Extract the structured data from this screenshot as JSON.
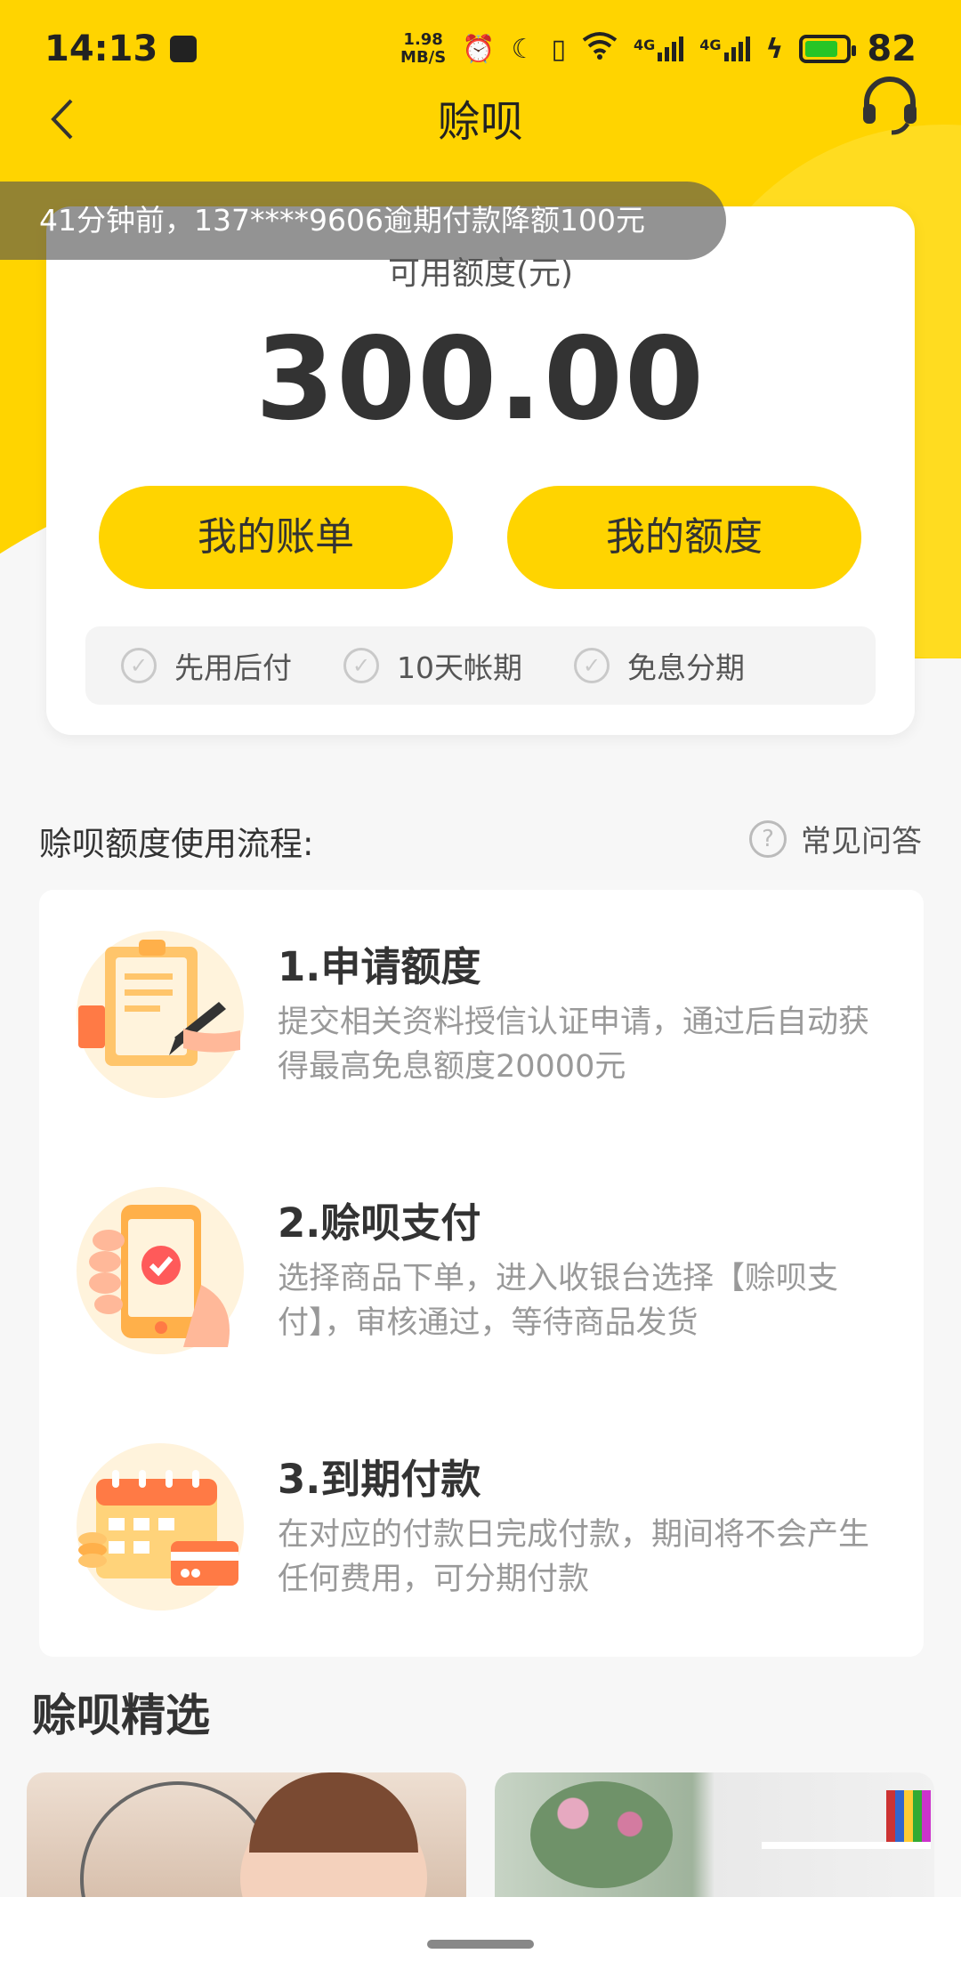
{
  "status_bar": {
    "time": "14:13",
    "net_speed_value": "1.98",
    "net_speed_unit": "MB/S",
    "network_1": "4G",
    "network_2": "4G",
    "battery": "82"
  },
  "nav": {
    "title": "赊呗"
  },
  "ticker": {
    "text": "41分钟前，137****9606逾期付款降额100元"
  },
  "credit": {
    "label": "可用额度(元)",
    "amount": "300.00",
    "bill_button": "我的账单",
    "quota_button": "我的额度",
    "features": [
      "先用后付",
      "10天帐期",
      "免息分期"
    ]
  },
  "process": {
    "title": "赊呗额度使用流程:",
    "faq": "常见问答",
    "steps": [
      {
        "title": "1.申请额度",
        "desc": "提交相关资料授信认证申请，通过后自动获得最高免息额度20000元"
      },
      {
        "title": "2.赊呗支付",
        "desc": "选择商品下单，进入收银台选择【赊呗支付】，审核通过，等待商品发货"
      },
      {
        "title": "3.到期付款",
        "desc": "在对应的付款日完成付款，期间将不会产生任何费用，可分期付款"
      }
    ]
  },
  "picks": {
    "title": "赊呗精选"
  },
  "colors": {
    "accent": "#ffd400",
    "icon_orange": "#ff7a45",
    "icon_light": "#fff3dc"
  }
}
